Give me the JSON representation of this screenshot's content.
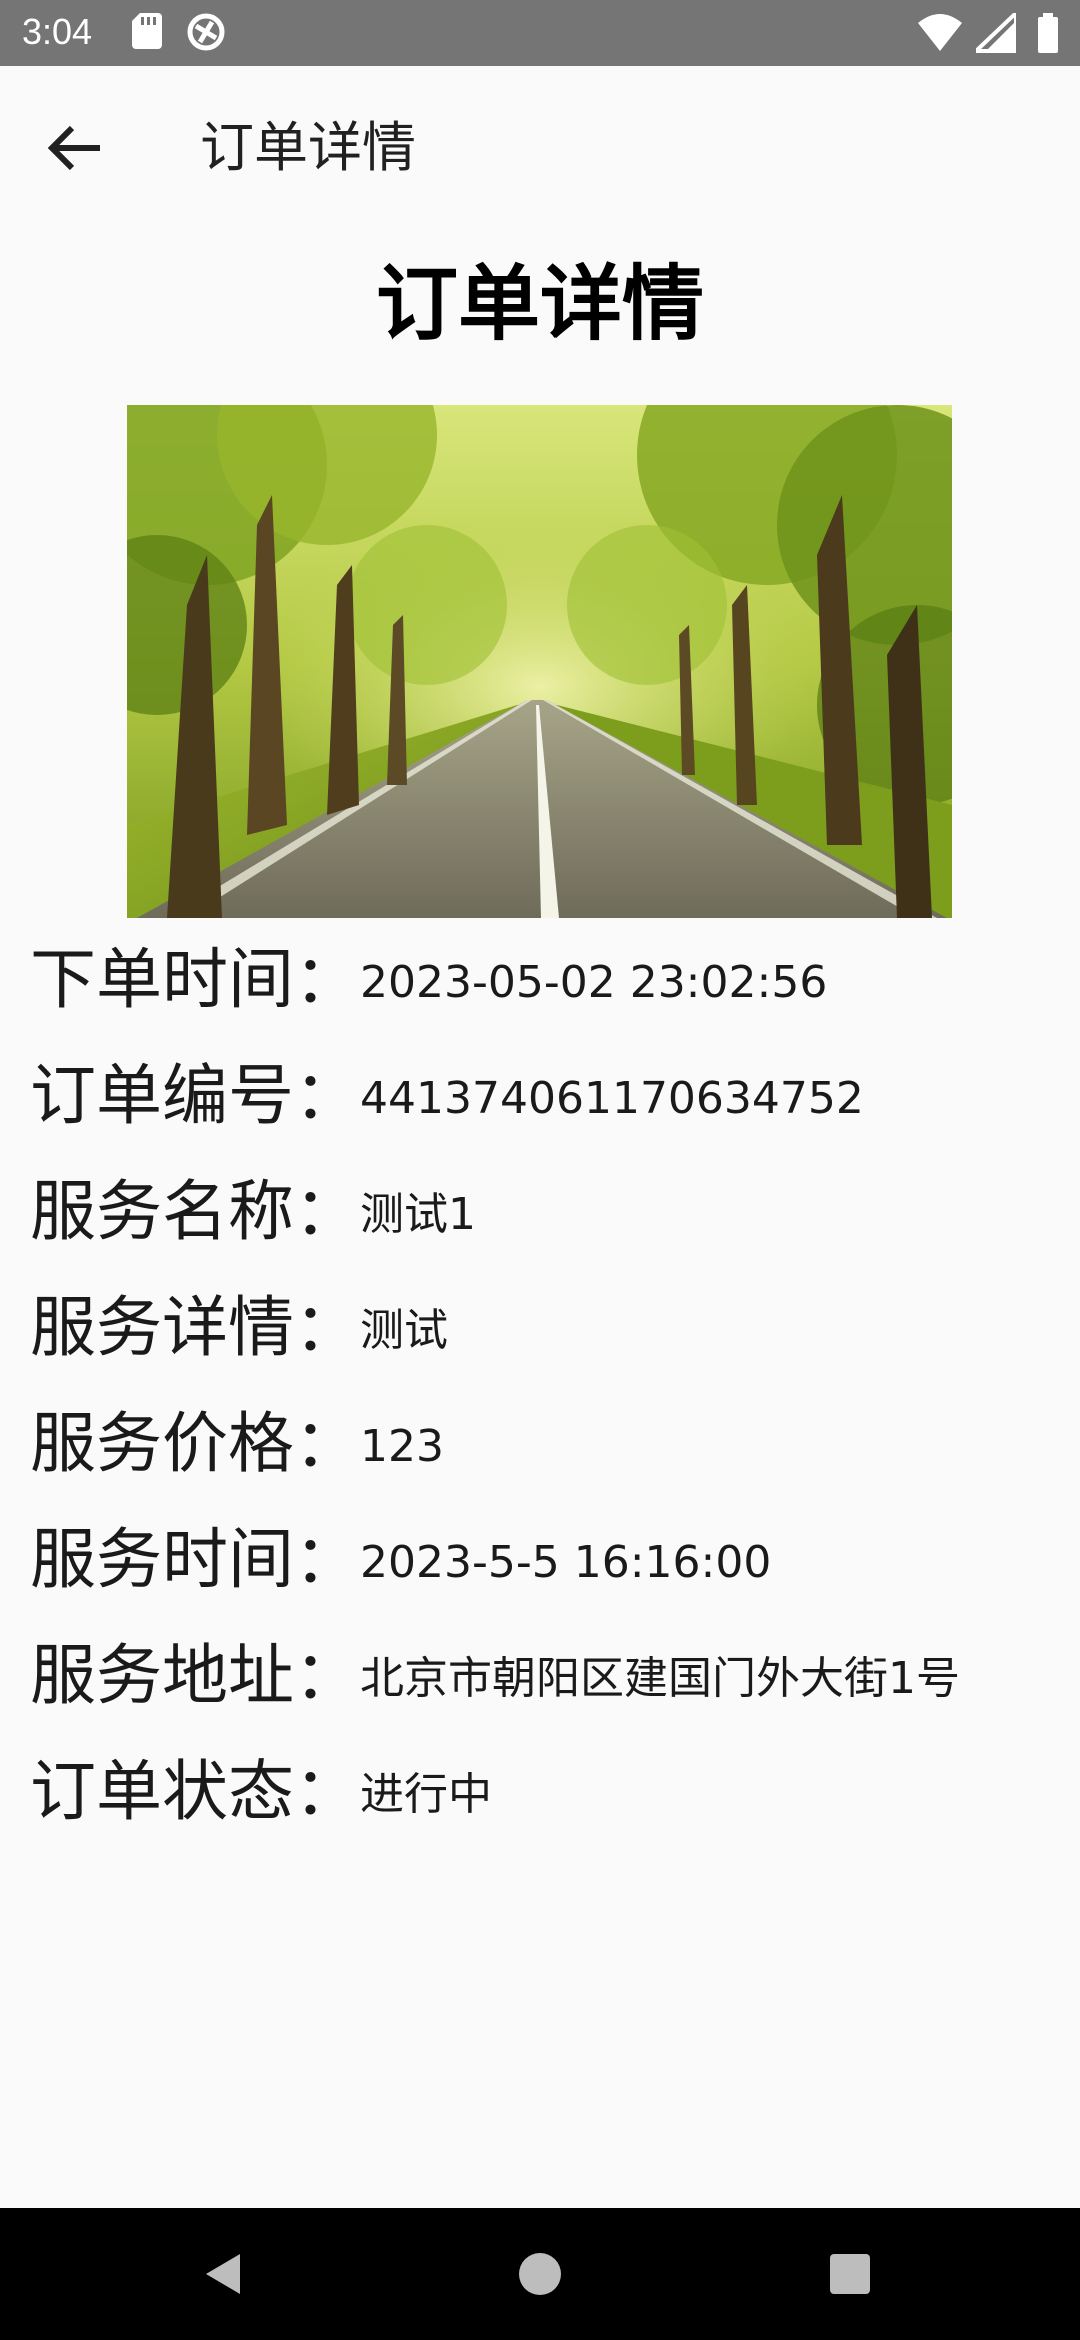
{
  "status_bar": {
    "time": "3:04",
    "left_icons": [
      "sd-card-icon",
      "sync-icon"
    ],
    "right_icons": [
      "wifi-icon",
      "cell-signal-icon",
      "battery-icon"
    ]
  },
  "app_bar": {
    "back_icon": "arrow-left-icon",
    "title": "订单详情"
  },
  "page": {
    "heading": "订单详情",
    "image": "tree-lined-road-photo"
  },
  "details": [
    {
      "label": "下单时间：",
      "value": "2023-05-02 23:02:56"
    },
    {
      "label": "订单编号：",
      "value": "441374061170634752"
    },
    {
      "label": "服务名称：",
      "value": "测试1"
    },
    {
      "label": "服务详情：",
      "value": "测试"
    },
    {
      "label": "服务价格：",
      "value": "123"
    },
    {
      "label": "服务时间：",
      "value": "2023-5-5 16:16:00"
    },
    {
      "label": "服务地址：",
      "value": "北京市朝阳区建国门外大街1号"
    },
    {
      "label": "订单状态：",
      "value": "进行中"
    }
  ],
  "nav_bar": {
    "buttons": [
      "back-triangle-icon",
      "home-circle-icon",
      "recents-square-icon"
    ]
  },
  "colors": {
    "status_bar": "#757575",
    "background": "#fafafa",
    "nav_bar": "#000000"
  }
}
